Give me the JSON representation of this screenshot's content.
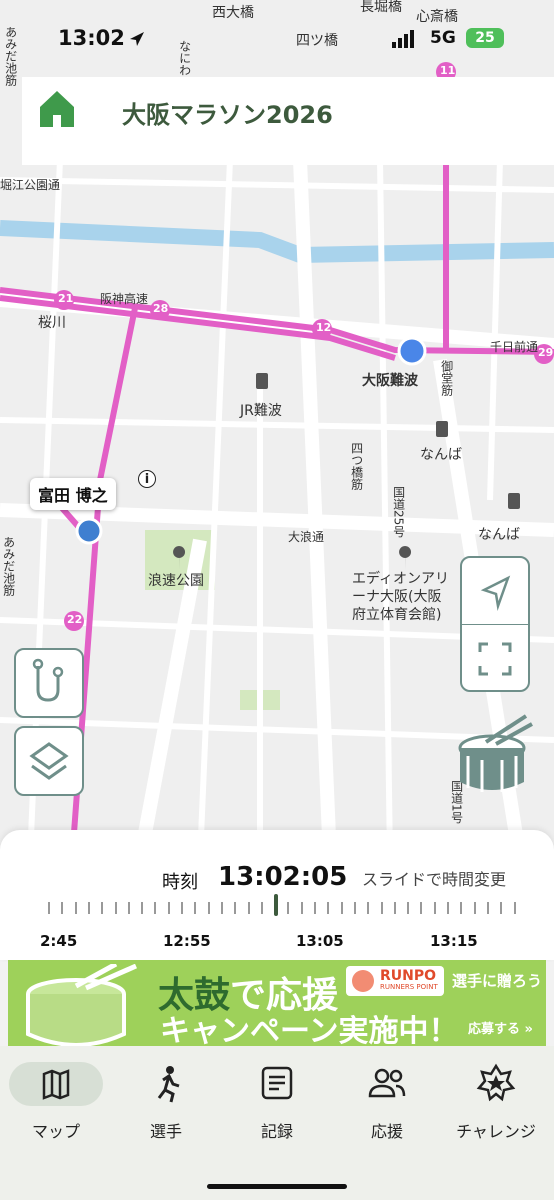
{
  "status_bar": {
    "time": "13:02",
    "network": "5G",
    "battery": "25"
  },
  "header": {
    "title": "大阪マラソン2026"
  },
  "map": {
    "labels": {
      "nishiohashi": "西大橋",
      "yotsubashi_top": "四ツ橋",
      "nagahoribashi": "長堀橋",
      "shinsaibashi": "心斎橋",
      "amidaike": "あみだ池筋",
      "naniwa": "なにわ",
      "horie": "堀江公園通",
      "sakuragawa": "桜川",
      "hanshin": "阪神高速",
      "osaka_namba": "大阪難波",
      "jr_namba": "JR難波",
      "sennichimae": "千日前通",
      "midosuji": "御堂筋",
      "namba1": "なんば",
      "namba2": "なんば",
      "yotsubashisuji": "四つ橋筋",
      "kokudo25": "国道25号",
      "dairoku": "大浪通",
      "naniwa_park": "浪速公園",
      "edion": "エディオンアリーナ大阪(大阪府立体育会館)",
      "amidaike2": "あみだ池筋",
      "kokudo": "国道1号"
    },
    "markers": {
      "km21": "21",
      "km28": "28",
      "km12": "12",
      "km22": "22",
      "km11": "11",
      "km29": "29"
    },
    "runner_name": "富田 博之",
    "info_symbol": "i"
  },
  "time_panel": {
    "label": "時刻",
    "current_time": "13:02:05",
    "hint": "スライドで時間変更",
    "ticks": [
      "2:45",
      "12:55",
      "13:05",
      "13:15"
    ]
  },
  "banner": {
    "headline_1a": "太鼓",
    "headline_1b": "で応援",
    "headline_2": "キャンペーン実施中！",
    "apply": "応募する »",
    "brand": "RUNPO",
    "brand_sub": "RUNNERS POINT",
    "gift": "選手に贈ろう"
  },
  "nav": {
    "items": [
      {
        "label": "マップ",
        "icon": "map-icon",
        "active": true
      },
      {
        "label": "選手",
        "icon": "runner-icon",
        "active": false
      },
      {
        "label": "記録",
        "icon": "record-icon",
        "active": false
      },
      {
        "label": "応援",
        "icon": "cheer-icon",
        "active": false
      },
      {
        "label": "チャレンジ",
        "icon": "challenge-icon",
        "active": false
      }
    ]
  },
  "colors": {
    "route": "#e25fc6",
    "accent": "#3d5a3d",
    "home": "#3f9a4b",
    "banner": "#9ed15a",
    "runner_dot": "#3f7fd0"
  }
}
